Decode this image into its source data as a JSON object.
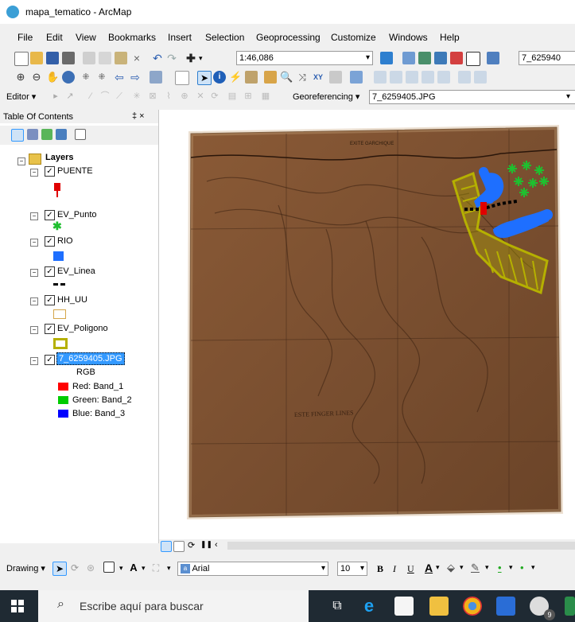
{
  "window": {
    "title": "mapa_tematico - ArcMap"
  },
  "menu": [
    "File",
    "Edit",
    "View",
    "Bookmarks",
    "Insert",
    "Selection",
    "Geoprocessing",
    "Customize",
    "Windows",
    "Help"
  ],
  "toolbar": {
    "scale_value": "1:46,086",
    "layer_combo_value": "7_625940"
  },
  "editor": {
    "editor_label": "Editor",
    "georef_label": "Georeferencing",
    "georef_layer": "7_6259405.JPG"
  },
  "toc": {
    "title": "Table Of Contents",
    "pin": "‡ ×",
    "root": "Layers",
    "layers": [
      {
        "name": "PUENTE"
      },
      {
        "name": "EV_Punto"
      },
      {
        "name": "RIO"
      },
      {
        "name": "EV_Linea"
      },
      {
        "name": "HH_UU"
      },
      {
        "name": "EV_Poligono"
      },
      {
        "name": "7_6259405.JPG",
        "selected": true,
        "sublabel": "RGB",
        "bands": [
          {
            "label": "Red:",
            "band": "Band_1",
            "color": "#ff0000"
          },
          {
            "label": "Green:",
            "band": "Band_2",
            "color": "#00cc00"
          },
          {
            "label": "Blue:",
            "band": "Band_3",
            "color": "#0000ff"
          }
        ]
      }
    ]
  },
  "map": {
    "top_label": "EXITE GARCHIQUE",
    "bottom_label": "ESTE FINGER LINES"
  },
  "drawing": {
    "drawing_label": "Drawing",
    "font_name": "Arial",
    "font_size": "10",
    "bold": "B",
    "italic": "I",
    "underline": "U",
    "font_color": "A"
  },
  "taskbar": {
    "search_placeholder": "Escribe aquí para buscar",
    "badge": "9"
  },
  "colors": {
    "selection": "#3399ff",
    "river": "#1e6fff",
    "polygon": "#b5b000",
    "parchment": "#8a5a36"
  }
}
